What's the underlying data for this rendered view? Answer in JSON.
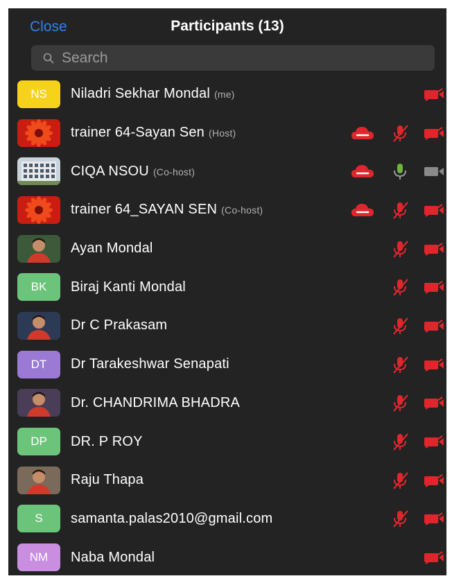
{
  "header": {
    "close_label": "Close",
    "title": "Participants (13)"
  },
  "search": {
    "placeholder": "Search"
  },
  "colors": {
    "background": "#232323",
    "accent": "#2f82f0",
    "muted_red": "#e0262d",
    "unmuted_green": "#6db33f"
  },
  "participants": [
    {
      "name": "Niladri Sekhar Mondal",
      "role": "(me)",
      "initials": "NS",
      "avatar_color": "#f7d21a",
      "avatar_kind": "initials",
      "cloud": false,
      "mic": "none",
      "camera": "off"
    },
    {
      "name": "trainer 64-Sayan Sen",
      "role": "(Host)",
      "initials": "",
      "avatar_color": "#c81d10",
      "avatar_kind": "flower",
      "cloud": true,
      "mic": "muted",
      "camera": "off"
    },
    {
      "name": "CIQA NSOU",
      "role": "(Co-host)",
      "initials": "",
      "avatar_color": "#6b7a88",
      "avatar_kind": "building",
      "cloud": true,
      "mic": "on",
      "camera": "on"
    },
    {
      "name": "trainer 64_SAYAN SEN",
      "role": "(Co-host)",
      "initials": "",
      "avatar_color": "#c81d10",
      "avatar_kind": "flower",
      "cloud": true,
      "mic": "muted",
      "camera": "off"
    },
    {
      "name": "Ayan Mondal",
      "role": "",
      "initials": "",
      "avatar_color": "#3c5a3a",
      "avatar_kind": "photo",
      "cloud": false,
      "mic": "muted",
      "camera": "off"
    },
    {
      "name": "Biraj Kanti Mondal",
      "role": "",
      "initials": "BK",
      "avatar_color": "#6cc47a",
      "avatar_kind": "initials",
      "cloud": false,
      "mic": "muted",
      "camera": "off"
    },
    {
      "name": "Dr C Prakasam",
      "role": "",
      "initials": "",
      "avatar_color": "#2d3a55",
      "avatar_kind": "photo",
      "cloud": false,
      "mic": "muted",
      "camera": "off"
    },
    {
      "name": "Dr Tarakeshwar Senapati",
      "role": "",
      "initials": "DT",
      "avatar_color": "#9b7ad6",
      "avatar_kind": "initials",
      "cloud": false,
      "mic": "muted",
      "camera": "off"
    },
    {
      "name": "Dr. CHANDRIMA BHADRA",
      "role": "",
      "initials": "",
      "avatar_color": "#4a3d58",
      "avatar_kind": "photo",
      "cloud": false,
      "mic": "muted",
      "camera": "off"
    },
    {
      "name": "DR. P ROY",
      "role": "",
      "initials": "DP",
      "avatar_color": "#6cc47a",
      "avatar_kind": "initials",
      "cloud": false,
      "mic": "muted",
      "camera": "off"
    },
    {
      "name": "Raju Thapa",
      "role": "",
      "initials": "",
      "avatar_color": "#7a6a5a",
      "avatar_kind": "photo",
      "cloud": false,
      "mic": "muted",
      "camera": "off"
    },
    {
      "name": "samanta.palas2010@gmail.com",
      "role": "",
      "initials": "S",
      "avatar_color": "#6cc47a",
      "avatar_kind": "initials",
      "cloud": false,
      "mic": "muted",
      "camera": "off"
    },
    {
      "name": "Naba Mondal",
      "role": "",
      "initials": "NM",
      "avatar_color": "#c98ee0",
      "avatar_kind": "initials",
      "cloud": false,
      "mic": "none",
      "camera": "off"
    }
  ]
}
